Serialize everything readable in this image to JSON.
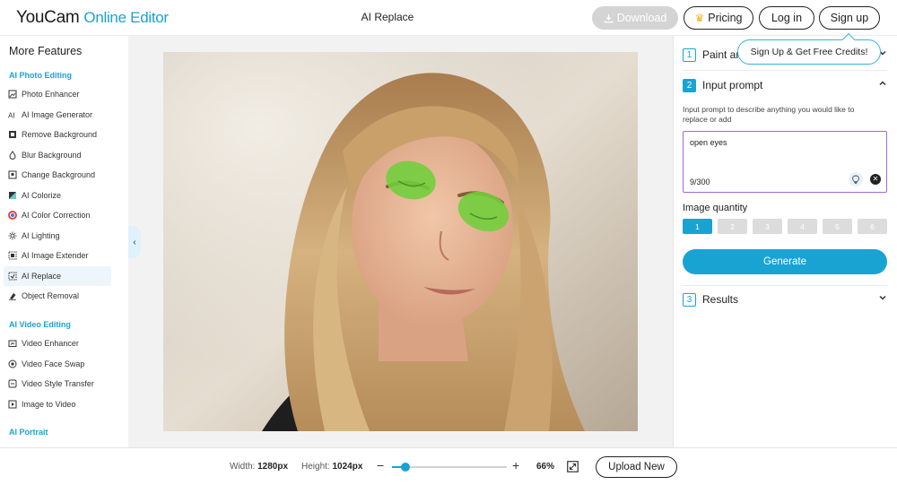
{
  "header": {
    "logo_brand": "YouCam",
    "logo_sub": "Online Editor",
    "page_title": "AI Replace",
    "download_label": "Download",
    "pricing_label": "Pricing",
    "login_label": "Log in",
    "signup_label": "Sign up",
    "signup_tooltip": "Sign Up & Get Free Credits!"
  },
  "sidebar": {
    "title": "More Features",
    "sections": {
      "photo": "AI Photo Editing",
      "video": "AI Video Editing",
      "portrait": "AI Portrait"
    },
    "photo_items": [
      {
        "label": "Photo Enhancer",
        "icon": "photo-enhancer-icon"
      },
      {
        "label": "AI Image Generator",
        "icon": "image-generator-icon"
      },
      {
        "label": "Remove Background",
        "icon": "remove-background-icon"
      },
      {
        "label": "Blur Background",
        "icon": "blur-background-icon"
      },
      {
        "label": "Change Background",
        "icon": "change-background-icon"
      },
      {
        "label": "AI Colorize",
        "icon": "colorize-icon"
      },
      {
        "label": "AI Color Correction",
        "icon": "color-correction-icon"
      },
      {
        "label": "AI Lighting",
        "icon": "lighting-icon"
      },
      {
        "label": "AI Image Extender",
        "icon": "image-extender-icon"
      },
      {
        "label": "AI Replace",
        "icon": "replace-icon"
      },
      {
        "label": "Object Removal",
        "icon": "object-removal-icon"
      }
    ],
    "video_items": [
      {
        "label": "Video Enhancer",
        "icon": "video-enhancer-icon"
      },
      {
        "label": "Video Face Swap",
        "icon": "video-face-swap-icon"
      },
      {
        "label": "Video Style Transfer",
        "icon": "video-style-transfer-icon"
      },
      {
        "label": "Image to Video",
        "icon": "image-to-video-icon"
      }
    ],
    "active_item": "AI Replace"
  },
  "panel": {
    "step1": {
      "num": "1",
      "label": "Paint ar"
    },
    "step2": {
      "num": "2",
      "label": "Input prompt"
    },
    "prompt_description": "Input prompt to describe anything you would like to replace or add",
    "prompt_value": "open eyes",
    "prompt_count": "9/300",
    "quantity_label": "Image quantity",
    "quantity_options": [
      "1",
      "2",
      "3",
      "4",
      "5",
      "6"
    ],
    "quantity_selected": "1",
    "generate_label": "Generate",
    "step3": {
      "num": "3",
      "label": "Results"
    }
  },
  "footer": {
    "width_label": "Width:",
    "width_value": "1280px",
    "height_label": "Height:",
    "height_value": "1024px",
    "zoom_minus": "−",
    "zoom_plus": "+",
    "zoom_fraction": 0.12,
    "zoom_percent": "66%",
    "upload_label": "Upload New"
  },
  "colors": {
    "accent": "#19a3d3",
    "prompt_border": "#9d6bd6",
    "mask_green": "#6fcf3a",
    "disabled": "#d4d4d4"
  }
}
